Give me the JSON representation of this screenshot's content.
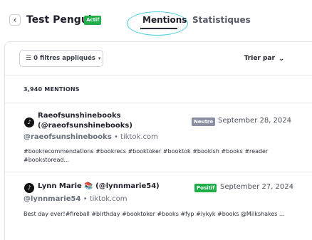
{
  "header": {
    "back_icon": "chevron-left-icon",
    "back_glyph": "‹",
    "title": "Test Penguin",
    "status_badge": "Actif",
    "tabs": [
      {
        "label": "Mentions",
        "active": true
      },
      {
        "label": "Statistiques",
        "active": false
      }
    ]
  },
  "toolbar": {
    "filters_label": "0 filtres appliqués",
    "sort_label": "Trier par"
  },
  "mentions_count": "3,940 MENTIONS",
  "mentions": [
    {
      "author": "Raeofsunshinebooks (@raeofsunshinebooks)",
      "handle": "@raeofsunshinebooks",
      "source": "tiktok.com",
      "sentiment": "Neutre",
      "date": "September 28, 2024",
      "text": "#bookrecommendations #bookrecs #booktoker #booktok #bookish #books #reader #bookstoread..."
    },
    {
      "author": "Lynn Marie 📚 (@lynnmarie54)",
      "handle": "@lynnmarie54",
      "source": "tiktok.com",
      "sentiment": "Positif",
      "date": "September 27, 2024",
      "text": "Best day ever!#fireball #birthday #booktoker #books #fyp #iykyk #books @Milkshakes ..."
    }
  ],
  "colors": {
    "badge_green": "#1fae4a",
    "neutral_gray": "#8a8fa3",
    "highlight_ring": "#47cde0"
  }
}
